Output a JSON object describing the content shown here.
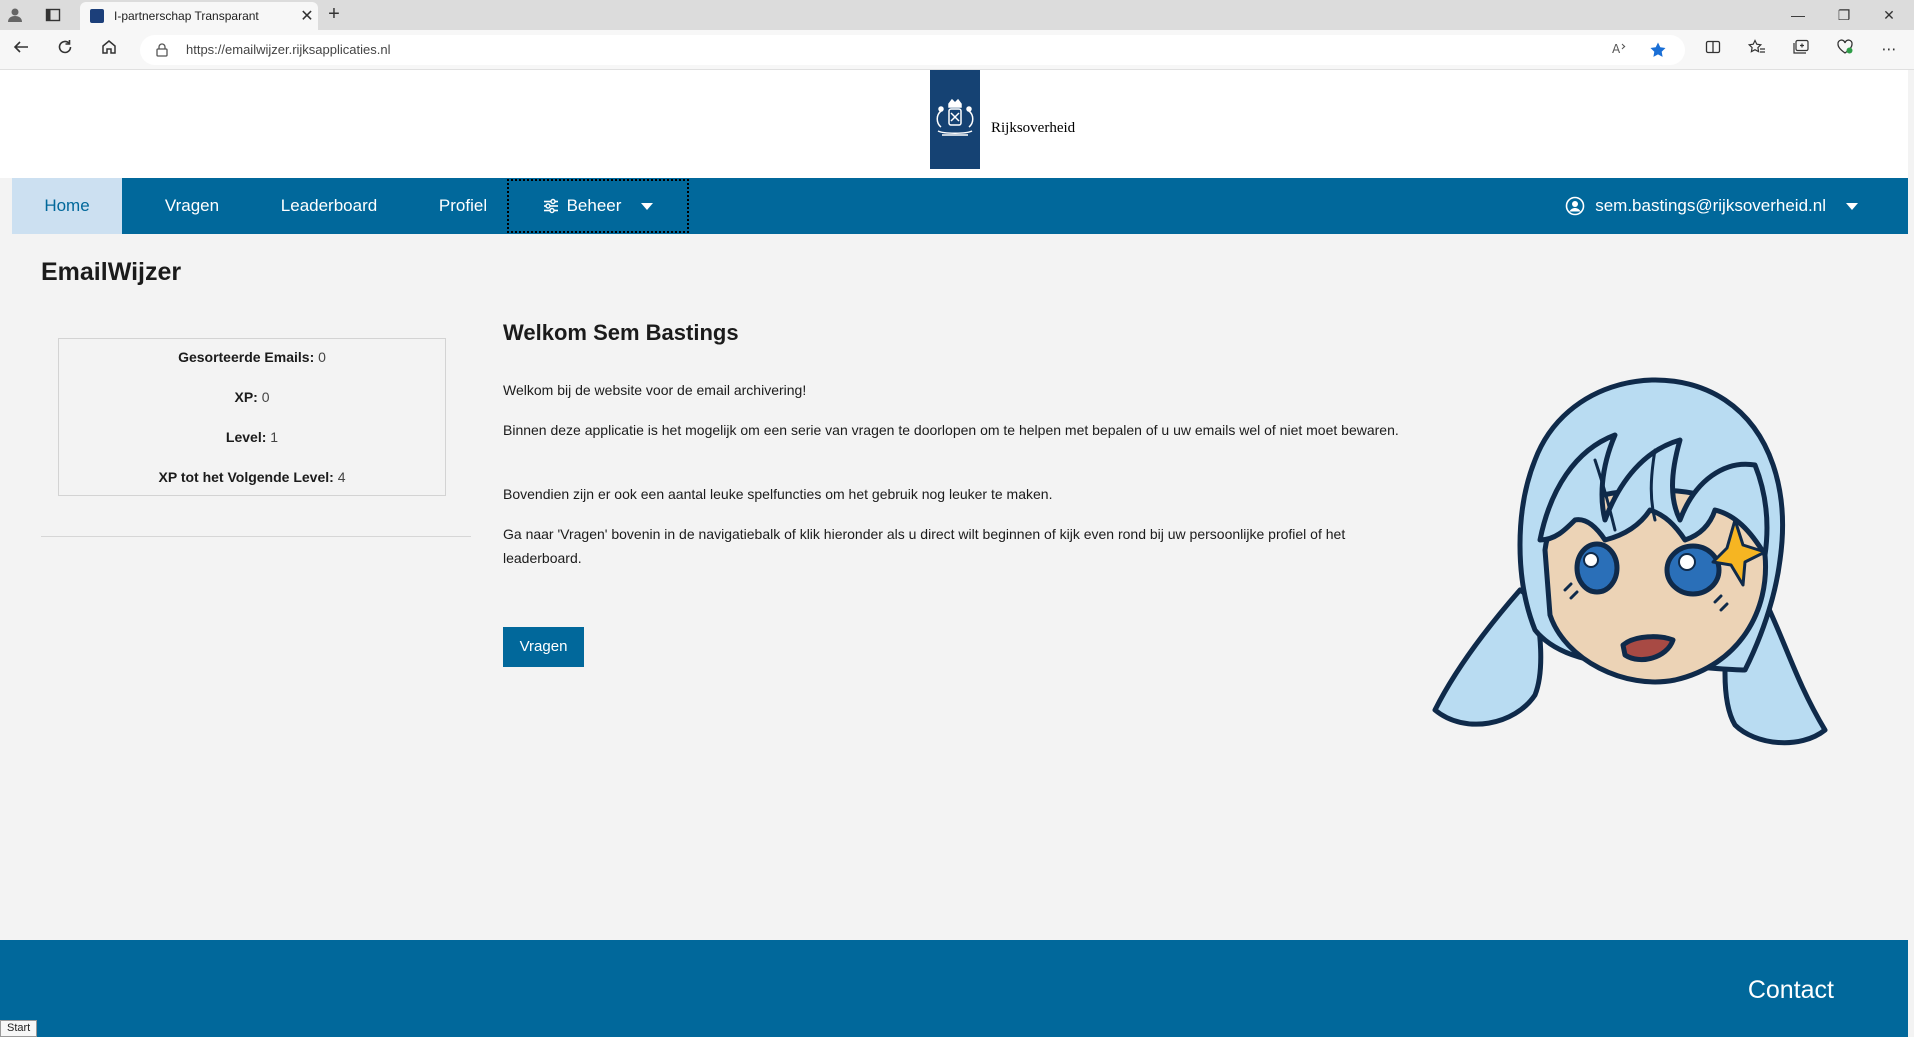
{
  "browser": {
    "tab_title": "I-partnerschap Transparant",
    "tab_close": "✕",
    "new_tab": "+",
    "url": "https://emailwijzer.rijksapplicaties.nl",
    "read_aloud": "Ă̩",
    "win_minimize": "—",
    "win_restore": "❐",
    "win_close": "✕",
    "more": "⋯"
  },
  "header": {
    "brand": "Rijksoverheid"
  },
  "nav": {
    "home": "Home",
    "vragen": "Vragen",
    "leaderboard": "Leaderboard",
    "profiel": "Profiel",
    "beheer": "Beheer",
    "user_email": "sem.bastings@rijksoverheid.nl"
  },
  "sidebar": {
    "app_title": "EmailWijzer",
    "stats": [
      {
        "label": "Gesorteerde Emails:",
        "value": "0"
      },
      {
        "label": "XP:",
        "value": "0"
      },
      {
        "label": "Level:",
        "value": "1"
      },
      {
        "label": "XP tot het Volgende Level:",
        "value": "4"
      }
    ]
  },
  "main": {
    "welcome_title": "Welkom Sem Bastings",
    "paragraphs": [
      "Welkom bij de website voor de email archivering!",
      "Binnen deze applicatie is het mogelijk om een serie van vragen te doorlopen om te helpen met bepalen of u uw emails wel of niet moet bewaren.",
      "Bovendien zijn er ook een aantal leuke spelfuncties om het gebruik nog leuker te maken.",
      "Ga naar 'Vragen' bovenin in de navigatiebalk of klik hieronder als u direct wilt beginnen of kijk even rond bij uw persoonlijke profiel of het leaderboard."
    ],
    "cta_button": "Vragen"
  },
  "footer": {
    "contact": "Contact"
  },
  "taskbar": {
    "start": "Start"
  },
  "colors": {
    "brand_blue": "#01689b",
    "ribbon_blue": "#154273",
    "active_nav_bg": "#cce0f1",
    "page_bg": "#f3f3f3"
  }
}
